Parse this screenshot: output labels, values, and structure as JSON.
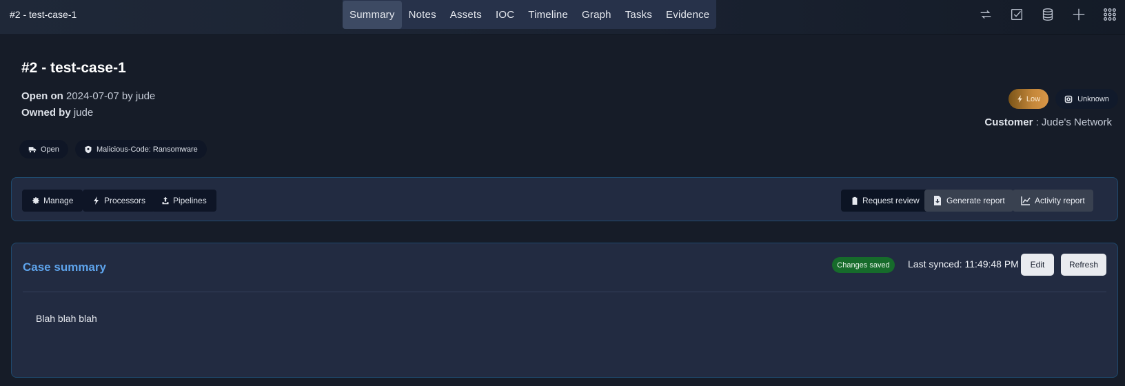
{
  "topbar": {
    "title": "#2 - test-case-1",
    "tabs": [
      "Summary",
      "Notes",
      "Assets",
      "IOC",
      "Timeline",
      "Graph",
      "Tasks",
      "Evidence"
    ],
    "active_tab": "Summary",
    "icons": [
      "refresh-icon",
      "checkbox-icon",
      "database-icon",
      "plus-icon",
      "apps-grid-icon"
    ]
  },
  "case": {
    "heading": "#2 - test-case-1",
    "open_on_label": "Open on",
    "open_on_value": "2024-07-07 by jude",
    "owned_by_label": "Owned by",
    "owned_by_value": "jude",
    "state_pill": "Open",
    "classification_pill": "Malicious-Code: Ransomware",
    "severity": "Low",
    "severity_color": "#c4873a",
    "status": "Unknown",
    "customer_label": "Customer",
    "customer_value": "Jude's Network"
  },
  "actions": {
    "manage": "Manage",
    "processors": "Processors",
    "pipelines": "Pipelines",
    "request_review": "Request review",
    "generate_report": "Generate report",
    "activity_report": "Activity report"
  },
  "summary": {
    "title": "Case summary",
    "saved_badge": "Changes saved",
    "saved_color": "#166b2b",
    "last_synced": "Last synced: 11:49:48 PM",
    "edit": "Edit",
    "refresh": "Refresh",
    "body": "Blah blah blah"
  }
}
